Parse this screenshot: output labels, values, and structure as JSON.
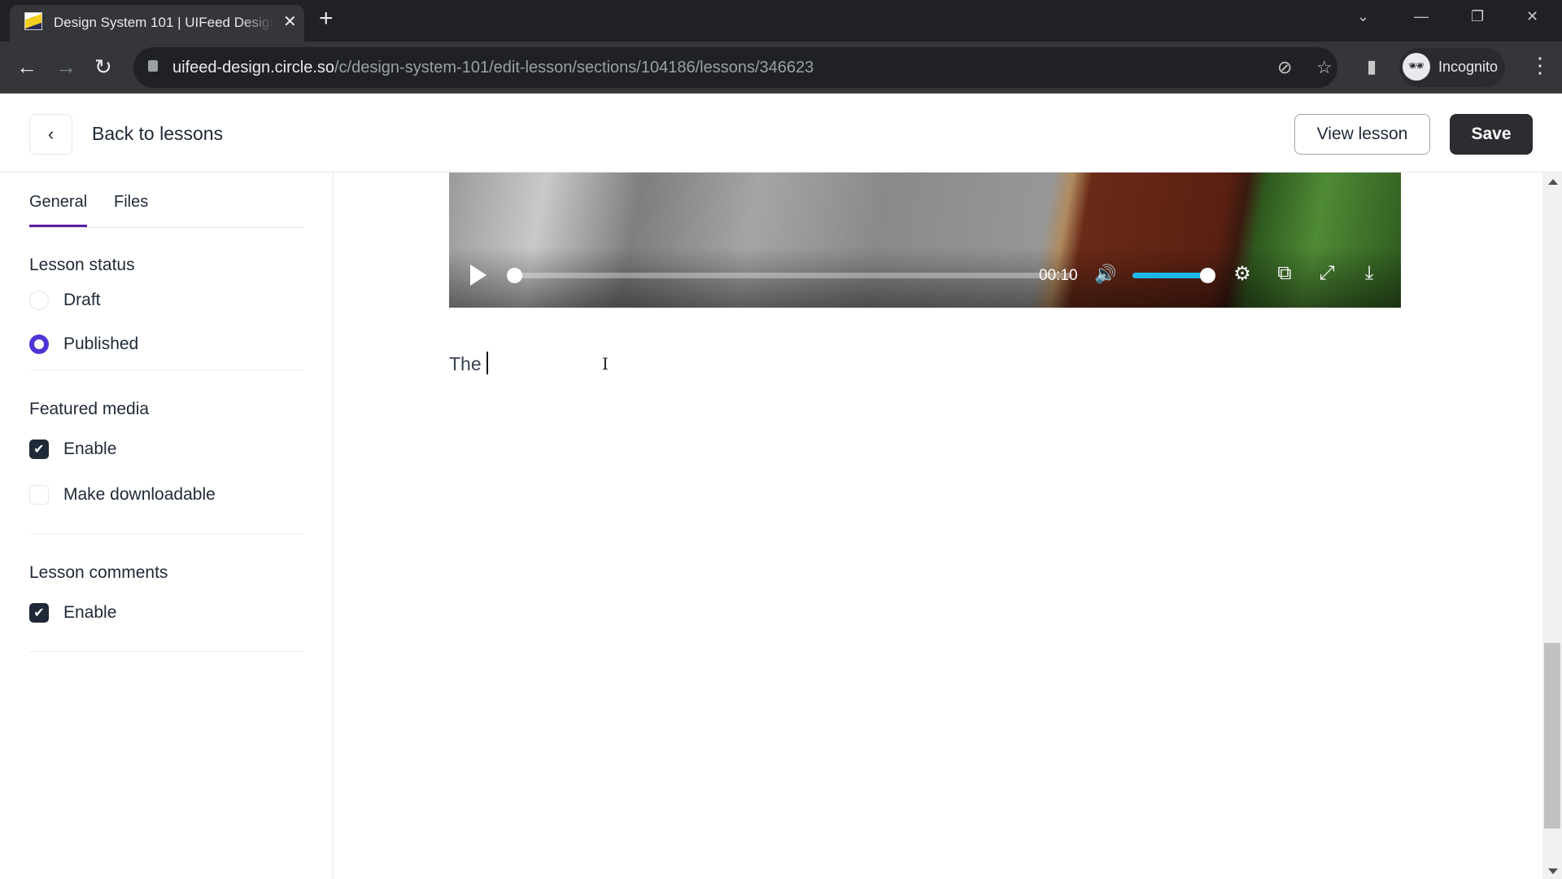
{
  "browser": {
    "tab_title": "Design System 101 | UIFeed Design",
    "url_host": "uifeed-design.circle.so",
    "url_path": "/c/design-system-101/edit-lesson/sections/104186/lessons/346623",
    "profile_label": "Incognito",
    "icons": {
      "close": "✕",
      "new_tab": "+",
      "tab_search": "⌄",
      "minimize": "—",
      "restore": "❐",
      "window_close": "✕",
      "back": "←",
      "forward": "→",
      "reload": "↻",
      "eye_off": "⊘",
      "star": "☆",
      "side_panel": "▮",
      "incognito": "🕶",
      "menu": "⋮"
    }
  },
  "header": {
    "back_icon": "‹",
    "back_label": "Back to lessons",
    "view_lesson_label": "View lesson",
    "save_label": "Save"
  },
  "sidebar": {
    "tabs": [
      {
        "label": "General",
        "active": true
      },
      {
        "label": "Files",
        "active": false
      }
    ],
    "lesson_status": {
      "title": "Lesson status",
      "options": [
        {
          "label": "Draft",
          "selected": false
        },
        {
          "label": "Published",
          "selected": true
        }
      ]
    },
    "featured_media": {
      "title": "Featured media",
      "options": [
        {
          "label": "Enable",
          "checked": true
        },
        {
          "label": "Make downloadable",
          "checked": false
        }
      ]
    },
    "lesson_comments": {
      "title": "Lesson comments",
      "options": [
        {
          "label": "Enable",
          "checked": true
        }
      ]
    },
    "check_glyph": "✔"
  },
  "player": {
    "time": "00:10",
    "progress_fraction": 0.0,
    "volume_fraction": 1.0,
    "icons": {
      "volume": "🔊",
      "settings": "⚙",
      "open_external": "⧉",
      "fullscreen": "⤢",
      "download": "⤓"
    },
    "accent_color": "#1ab7ea"
  },
  "editor": {
    "text": "The",
    "cursor_glyph": "I"
  }
}
